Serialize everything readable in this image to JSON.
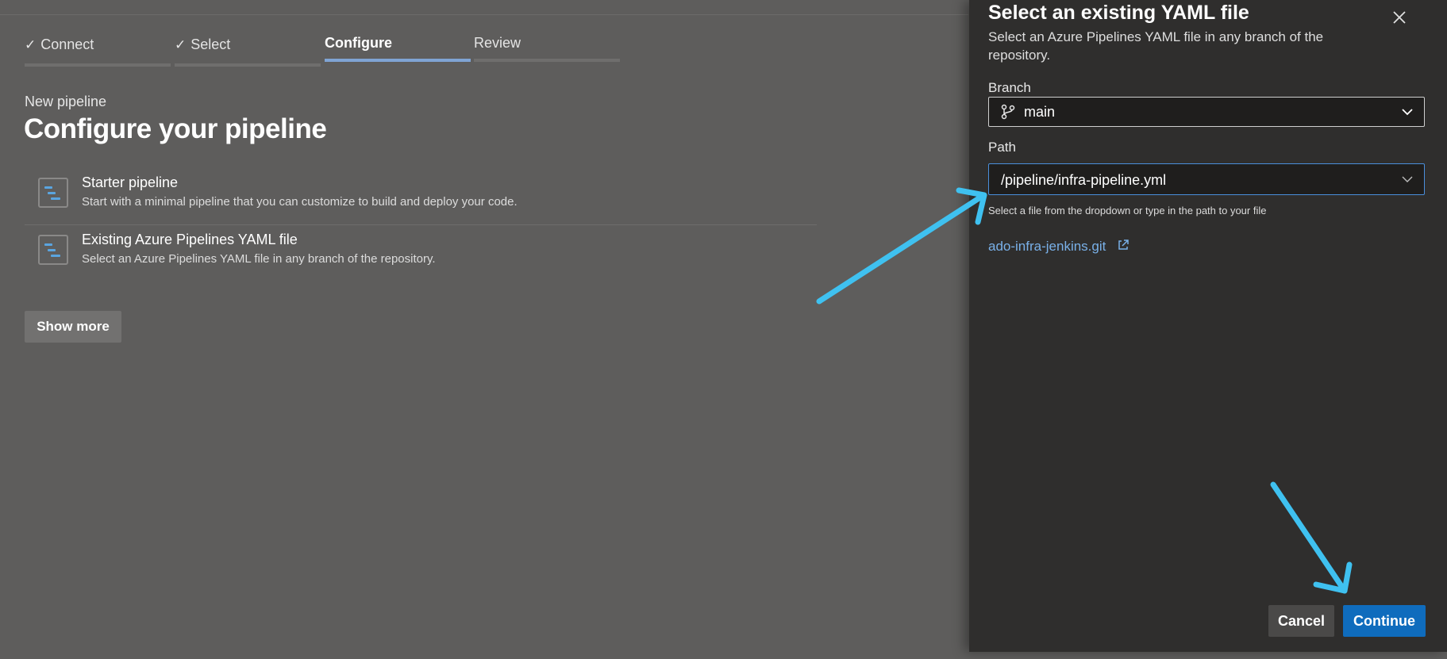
{
  "stepper": {
    "steps": [
      {
        "label": "Connect",
        "state": "done"
      },
      {
        "label": "Select",
        "state": "done"
      },
      {
        "label": "Configure",
        "state": "active"
      },
      {
        "label": "Review",
        "state": "pending"
      }
    ]
  },
  "main": {
    "eyebrow": "New pipeline",
    "title": "Configure your pipeline",
    "options": [
      {
        "title": "Starter pipeline",
        "description": "Start with a minimal pipeline that you can customize to build and deploy your code.",
        "icon": "pipeline-icon"
      },
      {
        "title": "Existing Azure Pipelines YAML file",
        "description": "Select an Azure Pipelines YAML file in any branch of the repository.",
        "icon": "pipeline-icon"
      }
    ],
    "show_more_label": "Show more"
  },
  "panel": {
    "title": "Select an existing YAML file",
    "subtitle": "Select an Azure Pipelines YAML file in any branch of the repository.",
    "branch_label": "Branch",
    "branch_value": "main",
    "path_label": "Path",
    "path_value": "/pipeline/infra-pipeline.yml",
    "helper_text": "Select a file from the dropdown or type in the path to your file",
    "repo_link": "ado-infra-jenkins.git",
    "cancel_label": "Cancel",
    "continue_label": "Continue"
  },
  "colors": {
    "background": "#5e5d5c",
    "panel": "#2f2e2d",
    "accent": "#0f6cbd",
    "link": "#79b0e8",
    "annotation_arrow": "#3fc1f0",
    "active_step": "#7fa4d4"
  }
}
